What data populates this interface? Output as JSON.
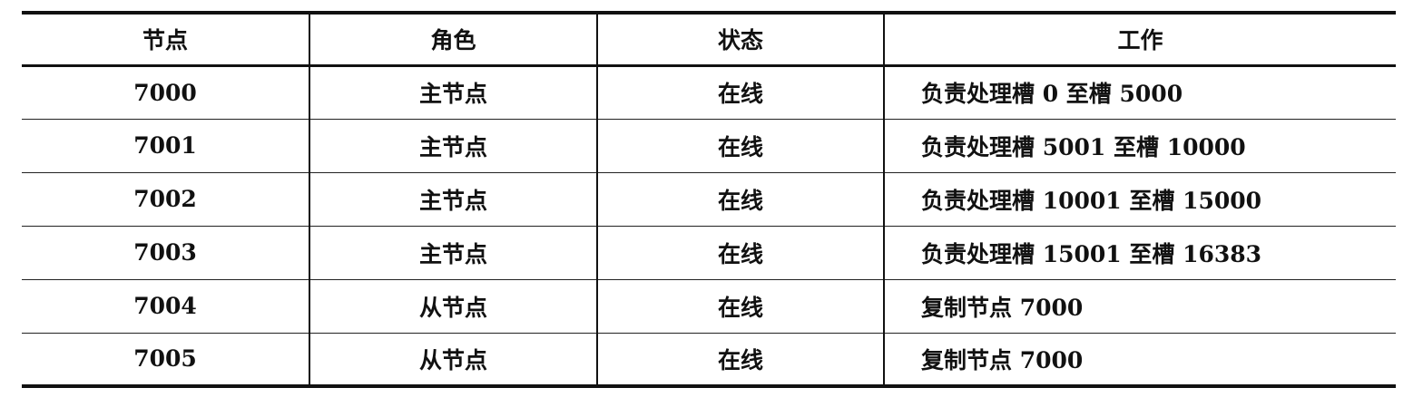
{
  "table": {
    "headers": [
      "节点",
      "角色",
      "状态",
      "工作"
    ],
    "rows": [
      [
        "7000",
        "主节点",
        "在线",
        "负责处理槽 0 至槽 5000"
      ],
      [
        "7001",
        "主节点",
        "在线",
        "负责处理槽 5001 至槽 10000"
      ],
      [
        "7002",
        "主节点",
        "在线",
        "负责处理槽 10001 至槽 15000"
      ],
      [
        "7003",
        "主节点",
        "在线",
        "负责处理槽 15001 至槽 16383"
      ],
      [
        "7004",
        "从节点",
        "在线",
        "复制节点 7000"
      ],
      [
        "7005",
        "从节点",
        "在线",
        "复制节点 7000"
      ]
    ]
  }
}
